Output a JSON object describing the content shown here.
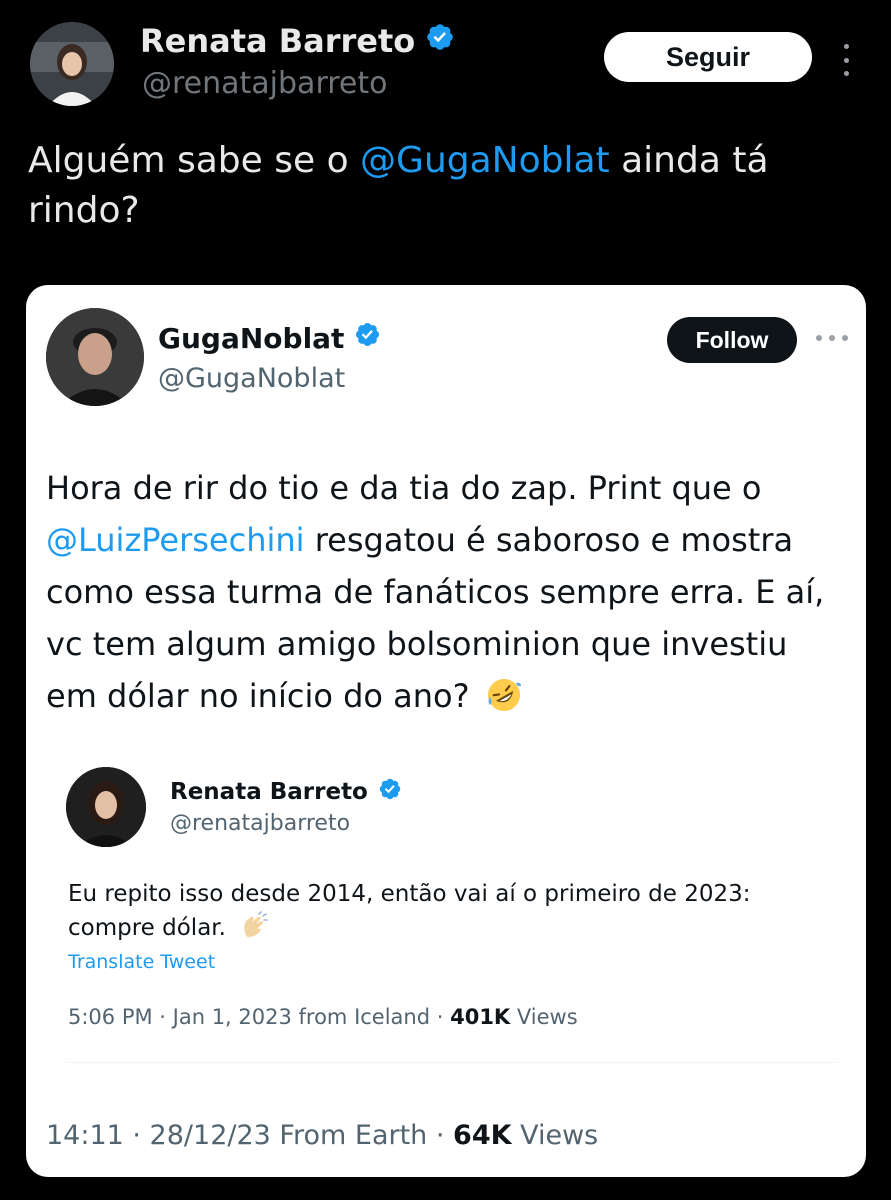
{
  "outer_tweet": {
    "author_name": "Renata Barreto",
    "author_handle": "@renatajbarreto",
    "follow_label": "Seguir",
    "text_before": "Alguém sabe se o ",
    "mention": "@GugaNoblat",
    "text_after": " ainda tá rindo?"
  },
  "quoted_tweet": {
    "author_name": "GugaNoblat",
    "author_handle": "@GugaNoblat",
    "follow_label": "Follow",
    "text_part1": "Hora de rir do tio e da tia do zap. Print que o ",
    "mention": "@LuizPersechini",
    "text_part2": " resgatou é saboroso e mostra como essa turma de fanáticos sempre erra. E aí, vc tem algum amigo bolsominion que investiu em dólar no início do ano?",
    "emoji_icon": "rolling-on-floor-laughing-icon",
    "timestamp": "14:11 · 28/12/23 From Earth · ",
    "views_count": "64K",
    "views_label": " Views"
  },
  "inner_tweet": {
    "author_name": "Renata Barreto",
    "author_handle": "@renatajbarreto",
    "text": "Eu repito isso desde 2014, então vai aí o primeiro de 2023: compre dólar.",
    "emoji_icon": "clapping-hands-icon",
    "translate_label": "Translate Tweet",
    "timestamp": "5:06 PM · Jan 1, 2023 from Iceland · ",
    "views_count": "401K",
    "views_label": " Views"
  },
  "colors": {
    "background": "#000000",
    "link_blue": "#1d9bf0",
    "verified_blue": "#1d9bf0",
    "card_background": "#ffffff"
  }
}
